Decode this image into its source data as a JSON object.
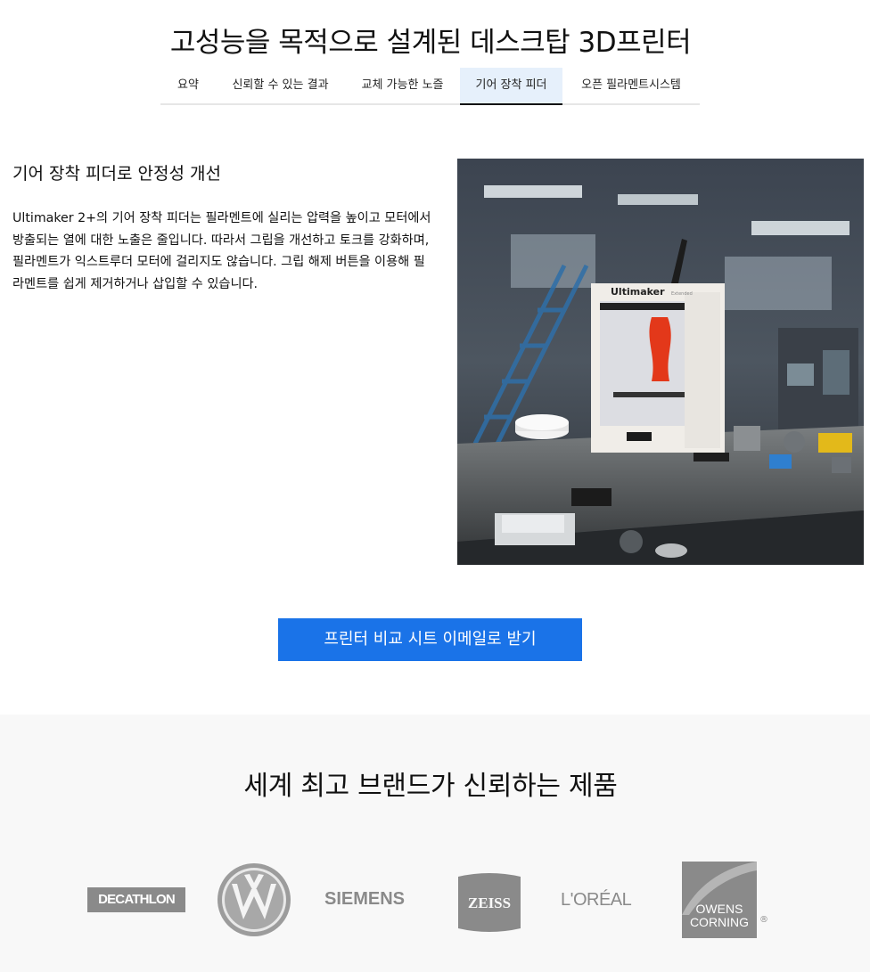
{
  "page": {
    "title": "고성능을 목적으로 설계된 데스크탑 3D프린터"
  },
  "tabs": [
    {
      "label": "요약"
    },
    {
      "label": "신뢰할 수 있는 결과"
    },
    {
      "label": "교체 가능한 노즐"
    },
    {
      "label": "기어 장착 피더"
    },
    {
      "label": "오픈 필라멘트시스템"
    }
  ],
  "feature": {
    "heading": "기어 장착 피더로 안정성 개선",
    "body": "Ultimaker 2+의 기어 장착 피더는 필라멘트에 실리는 압력을 높이고 모터에서 방출되는 열에 대한 노출은 줄입니다. 따라서 그립을 개선하고 토크를 강화하며, 필라멘트가 익스트루더 모터에 걸리지도 않습니다. 그립 해제 버튼을 이용해 필라멘트를 쉽게 제거하거나 삽입할 수 있습니다.",
    "printer_brand": "Ultimaker",
    "printer_badge": "Extended"
  },
  "cta": {
    "label": "프린터 비교 시트 이메일로 받기"
  },
  "brands": {
    "heading": "세계 최고 브랜드가 신뢰하는 제품",
    "logos": {
      "decathlon": "DECATHLON",
      "vw": "VW",
      "siemens": "SIEMENS",
      "zeiss": "ZEISS",
      "loreal": "L'ORÉAL",
      "owens_line1": "OWENS",
      "owens_line2": "CORNING",
      "registered": "®"
    }
  },
  "colors": {
    "accent": "#1a73e8",
    "active_tab_bg": "#e6f0fb",
    "logo_gray": "#8a8a8a",
    "section_bg": "#f8f8f8"
  }
}
